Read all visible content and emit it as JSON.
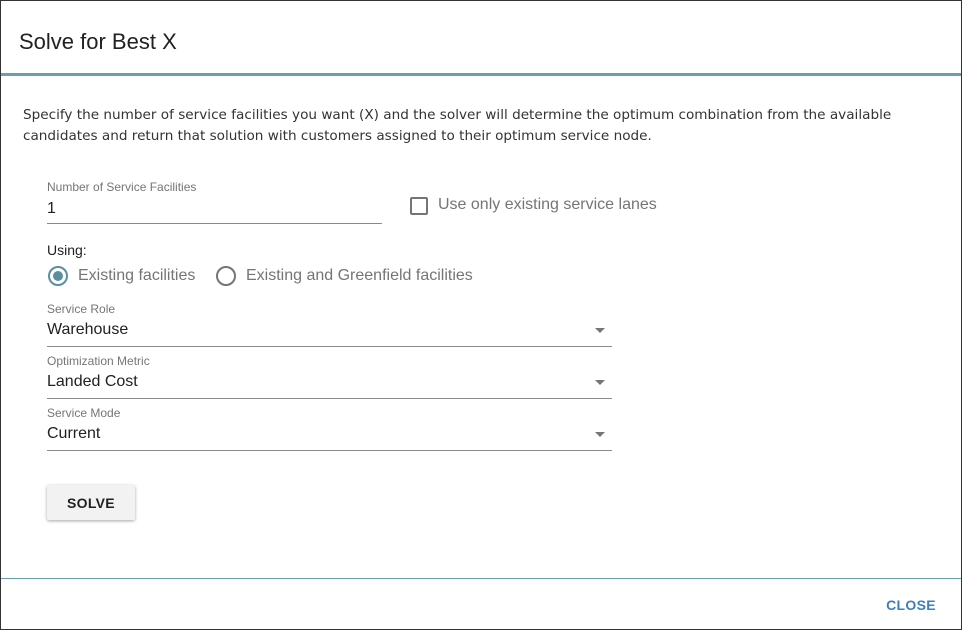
{
  "dialog": {
    "title": "Solve for Best X",
    "description": "Specify the number of service facilities you want (X) and the solver will determine the optimum combination from the available candidates and return that solution with customers assigned to their optimum service node."
  },
  "facilities_count": {
    "label": "Number of Service Facilities",
    "value": "1"
  },
  "existing_lanes": {
    "label": "Use only existing service lanes",
    "checked": false
  },
  "using": {
    "label": "Using:",
    "options": [
      {
        "label": "Existing facilities",
        "selected": true
      },
      {
        "label": "Existing and Greenfield facilities",
        "selected": false
      }
    ]
  },
  "service_role": {
    "label": "Service Role",
    "value": "Warehouse"
  },
  "optimization_metric": {
    "label": "Optimization Metric",
    "value": "Landed Cost"
  },
  "service_mode": {
    "label": "Service Mode",
    "value": "Current"
  },
  "actions": {
    "solve_label": "SOLVE",
    "close_label": "CLOSE"
  },
  "colors": {
    "accent": "#6a9fad",
    "radio_selected": "#5b8fa0",
    "link_button": "#3f7fbf"
  }
}
